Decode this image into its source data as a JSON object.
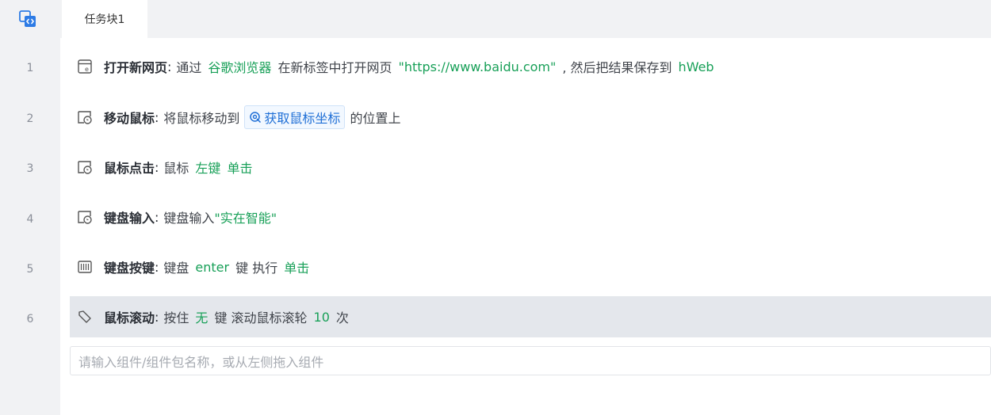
{
  "tab": {
    "label": "任务块1"
  },
  "line_numbers": [
    "1",
    "2",
    "3",
    "4",
    "5",
    "6"
  ],
  "steps": [
    {
      "title": "打开新网页",
      "colon": ":",
      "icon": "browser-icon",
      "t1": "通过",
      "browser": "谷歌浏览器",
      "t2": "在新标签中打开网页",
      "url": "\"https://www.baidu.com\"",
      "t3": ", 然后把结果保存到",
      "var": "hWeb"
    },
    {
      "title": "移动鼠标",
      "colon": ":",
      "icon": "mouse-icon",
      "t1": "将鼠标移动到",
      "chip": "获取鼠标坐标",
      "t2": "的位置上"
    },
    {
      "title": "鼠标点击",
      "colon": ":",
      "icon": "mouse-icon",
      "t1": "鼠标",
      "button": "左键",
      "action": "单击"
    },
    {
      "title": "键盘输入",
      "colon": ":",
      "icon": "mouse-icon",
      "t1": "键盘输入",
      "text": "\"实在智能\""
    },
    {
      "title": "键盘按键",
      "colon": ":",
      "icon": "keyboard-icon",
      "t1": "键盘",
      "key": "enter",
      "t2": "键 执行",
      "action": "单击"
    },
    {
      "title": "鼠标滚动",
      "colon": ":",
      "icon": "scroll-icon",
      "t1": "按住",
      "modifier": "无",
      "t2": "键 滚动鼠标滚轮",
      "count": "10",
      "t3": "次"
    }
  ],
  "add_component": {
    "placeholder": "请输入组件/组件包名称，或从左侧拖入组件"
  },
  "colors": {
    "highlight": "#18a058",
    "chip": "#1f6fd6",
    "selected_row": "#e4e7ec",
    "gutter": "#f1f2f4"
  }
}
